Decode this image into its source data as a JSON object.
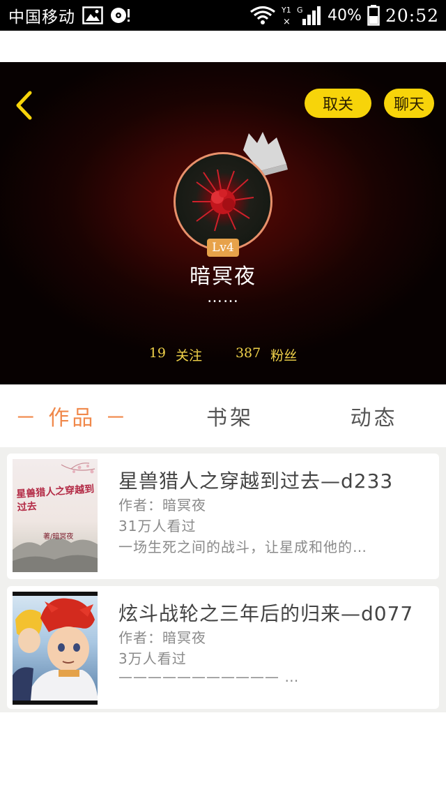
{
  "status_bar": {
    "carrier": "中国移动",
    "signal_label": "Y1",
    "network_label": "G",
    "battery_percent": "40%",
    "time": "20:52"
  },
  "profile": {
    "unfollow_label": "取关",
    "chat_label": "聊天",
    "level": "Lv4",
    "username": "暗冥夜",
    "bio": "……",
    "following_count": "19",
    "following_label": "关注",
    "followers_count": "387",
    "followers_label": "粉丝"
  },
  "tabs": {
    "works": "－ 作品 －",
    "bookshelf": "书架",
    "activity": "动态"
  },
  "works": [
    {
      "title": "星兽猎人之穿越到过去—d233",
      "author": "作者：暗冥夜",
      "views": "31万人看过",
      "description": "一场生死之间的战斗，让星成和他的…",
      "cover_text": "星兽猎人之穿越到过去",
      "cover_author": "著/暗冥夜"
    },
    {
      "title": "炫斗战轮之三年后的归来—d077",
      "author": "作者：暗冥夜",
      "views": "3万人看过",
      "description": "——————————— …"
    }
  ],
  "colors": {
    "accent_yellow": "#f7d40a",
    "active_tab": "#f0884a",
    "level_badge": "#e7a24a",
    "stats_text": "#f0d24a"
  }
}
